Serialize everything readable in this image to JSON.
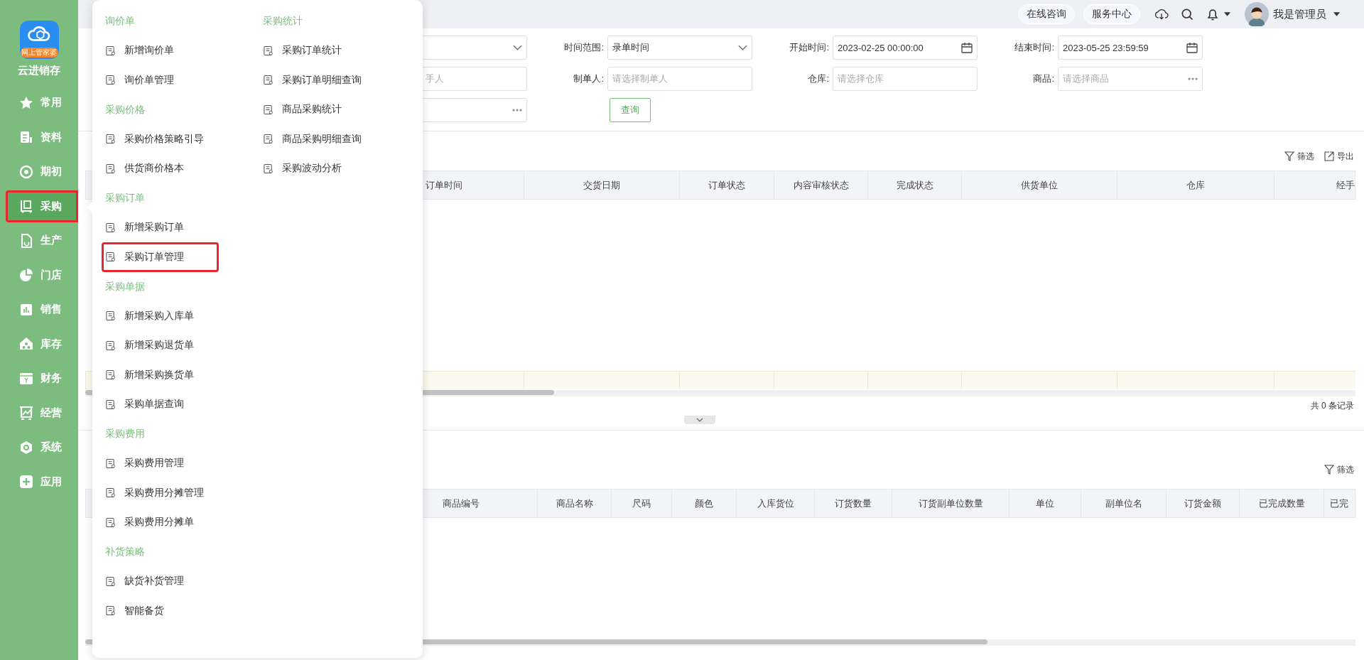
{
  "sidebar": {
    "logo_badge": "网上管家婆",
    "brand": "云进销存",
    "items": [
      {
        "label": "常用",
        "selected": false,
        "highlighted": false
      },
      {
        "label": "资料",
        "selected": false,
        "highlighted": false
      },
      {
        "label": "期初",
        "selected": false,
        "highlighted": false
      },
      {
        "label": "采购",
        "selected": true,
        "highlighted": true
      },
      {
        "label": "生产",
        "selected": false,
        "highlighted": false
      },
      {
        "label": "门店",
        "selected": false,
        "highlighted": false
      },
      {
        "label": "销售",
        "selected": false,
        "highlighted": false
      },
      {
        "label": "库存",
        "selected": false,
        "highlighted": false
      },
      {
        "label": "财务",
        "selected": false,
        "highlighted": false
      },
      {
        "label": "经营",
        "selected": false,
        "highlighted": false
      },
      {
        "label": "系统",
        "selected": false,
        "highlighted": false
      },
      {
        "label": "应用",
        "selected": false,
        "highlighted": false
      }
    ]
  },
  "flyout": {
    "columns": [
      {
        "groups": [
          {
            "title": "询价单",
            "items": [
              {
                "label": "新增询价单",
                "highlighted": false
              },
              {
                "label": "询价单管理",
                "highlighted": false
              }
            ]
          },
          {
            "title": "采购价格",
            "items": [
              {
                "label": "采购价格策略引导",
                "highlighted": false
              },
              {
                "label": "供货商价格本",
                "highlighted": false
              }
            ]
          },
          {
            "title": "采购订单",
            "items": [
              {
                "label": "新增采购订单",
                "highlighted": false
              },
              {
                "label": "采购订单管理",
                "highlighted": true
              }
            ]
          },
          {
            "title": "采购单据",
            "items": [
              {
                "label": "新增采购入库单",
                "highlighted": false
              },
              {
                "label": "新增采购退货单",
                "highlighted": false
              },
              {
                "label": "新增采购换货单",
                "highlighted": false
              },
              {
                "label": "采购单据查询",
                "highlighted": false
              }
            ]
          },
          {
            "title": "采购费用",
            "items": [
              {
                "label": "采购费用管理",
                "highlighted": false
              },
              {
                "label": "采购费用分摊管理",
                "highlighted": false
              },
              {
                "label": "采购费用分摊单",
                "highlighted": false
              }
            ]
          },
          {
            "title": "补货策略",
            "items": [
              {
                "label": "缺货补货管理",
                "highlighted": false
              },
              {
                "label": "智能备货",
                "highlighted": false
              }
            ]
          }
        ]
      },
      {
        "groups": [
          {
            "title": "采购统计",
            "items": [
              {
                "label": "采购订单统计",
                "highlighted": false
              },
              {
                "label": "采购订单明细查询",
                "highlighted": false
              },
              {
                "label": "商品采购统计",
                "highlighted": false
              },
              {
                "label": "商品采购明细查询",
                "highlighted": false
              },
              {
                "label": "采购波动分析",
                "highlighted": false
              }
            ]
          }
        ]
      }
    ]
  },
  "top_bar": {
    "buttons": [
      "在线咨询",
      "服务中心"
    ],
    "user": "我是管理员"
  },
  "filters": [
    [
      {
        "kind": "select"
      },
      {
        "kind": "select",
        "label": "时间范围:",
        "value": "录单时间"
      },
      {
        "kind": "date",
        "label": "开始时间:",
        "value": "2023-02-25 00:00:00"
      },
      {
        "kind": "date",
        "label": "结束时间:",
        "value": "2023-05-25 23:59:59"
      }
    ],
    [
      {
        "kind": "text",
        "placeholder": "手人"
      },
      {
        "kind": "text",
        "label": "制单人:",
        "placeholder": "请选择制单人"
      },
      {
        "kind": "text",
        "label": "仓库:",
        "placeholder": "请选择仓库"
      },
      {
        "kind": "picker",
        "label": "商品:",
        "placeholder": "请选择商品"
      }
    ],
    [
      {
        "kind": "picker"
      },
      {
        "kind": "button",
        "value": "查询"
      }
    ]
  ],
  "orders": {
    "tools": [
      {
        "label": "筛选",
        "kind": "filter"
      },
      {
        "label": "导出",
        "kind": "export"
      }
    ],
    "columns": [
      "订单时间",
      "交货日期",
      "订单状态",
      "内容审核状态",
      "完成状态",
      "供货单位",
      "仓库",
      "经手"
    ],
    "footer": "共 0 条记录"
  },
  "details": {
    "tools": [
      {
        "label": "筛选",
        "kind": "filter"
      }
    ],
    "columns": [
      "商品编号",
      "商品名称",
      "尺码",
      "颜色",
      "入库货位",
      "订货数量",
      "订货副单位数量",
      "单位",
      "副单位名",
      "订货金额",
      "已完成数量",
      "已完"
    ]
  }
}
